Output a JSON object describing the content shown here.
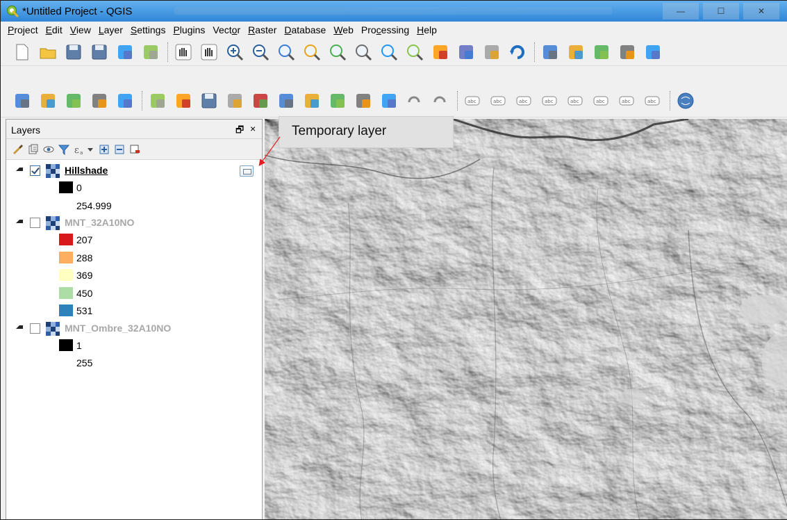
{
  "window": {
    "title": "*Untitled Project - QGIS",
    "controls": [
      "—",
      "☐",
      "✕"
    ]
  },
  "menubar": {
    "items": [
      {
        "label": "Project",
        "u": "P"
      },
      {
        "label": "Edit",
        "u": "E"
      },
      {
        "label": "View",
        "u": "V"
      },
      {
        "label": "Layer",
        "u": "L"
      },
      {
        "label": "Settings",
        "u": "S"
      },
      {
        "label": "Plugins",
        "u": "P"
      },
      {
        "label": "Vector",
        "u": "o"
      },
      {
        "label": "Raster",
        "u": "R"
      },
      {
        "label": "Database",
        "u": "D"
      },
      {
        "label": "Web",
        "u": "W"
      },
      {
        "label": "Processing",
        "u": "c"
      },
      {
        "label": "Help",
        "u": "H"
      }
    ]
  },
  "layers_panel": {
    "title": "Layers",
    "float_glyph": "🗗",
    "close_glyph": "×",
    "layers": [
      {
        "name": "Hillshade",
        "checked": true,
        "active": true,
        "temporary": true,
        "legend": [
          {
            "color": "#000000",
            "label": "0"
          },
          {
            "color": null,
            "label": "254.999"
          }
        ]
      },
      {
        "name": "MNT_32A10NO",
        "checked": false,
        "active": false,
        "temporary": false,
        "legend": [
          {
            "color": "#d7191c",
            "label": "207"
          },
          {
            "color": "#fdae61",
            "label": "288"
          },
          {
            "color": "#ffffbf",
            "label": "369"
          },
          {
            "color": "#abdda4",
            "label": "450"
          },
          {
            "color": "#2b83ba",
            "label": "531"
          }
        ]
      },
      {
        "name": "MNT_Ombre_32A10NO",
        "checked": false,
        "active": false,
        "temporary": false,
        "legend": [
          {
            "color": "#000000",
            "label": "1"
          },
          {
            "color": null,
            "label": "255"
          }
        ]
      }
    ]
  },
  "callout": {
    "text": "Temporary layer"
  },
  "icons": {
    "toolbar1": [
      "new-project-icon",
      "open-project-icon",
      "save-project-icon",
      "save-as-icon",
      "new-print-layout-icon",
      "layout-manager-icon",
      "pan-icon",
      "pan-to-selection-icon",
      "zoom-in-icon",
      "zoom-out-icon",
      "zoom-native-icon",
      "zoom-full-icon",
      "zoom-selection-icon",
      "zoom-layer-icon",
      "zoom-last-icon",
      "zoom-next-icon",
      "new-bookmark-icon",
      "show-bookmarks-icon",
      "new-map-view-icon",
      "refresh-icon",
      "identify-icon",
      "select-radius-icon",
      "select-feature-icon",
      "deselect-icon",
      "attribute-table-icon"
    ],
    "toolbar2": [
      "add-vector-icon",
      "add-raster-icon",
      "digitize-icon",
      "new-shapefile-icon",
      "add-wms-icon",
      "toggle-editing-icon",
      "current-edits-icon",
      "save-edits-icon",
      "add-feature-icon",
      "move-feature-icon",
      "node-tool-icon",
      "delete-selected-icon",
      "cut-features-icon",
      "copy-features-icon",
      "paste-features-icon",
      "undo-icon",
      "redo-icon",
      "label-icon",
      "pin-labels-icon",
      "layer-labeling-icon",
      "highlight-pinned-icon",
      "show-hide-labels-icon",
      "move-label-icon",
      "rotate-label-icon",
      "change-label-icon",
      "plugin-globe-icon"
    ]
  }
}
